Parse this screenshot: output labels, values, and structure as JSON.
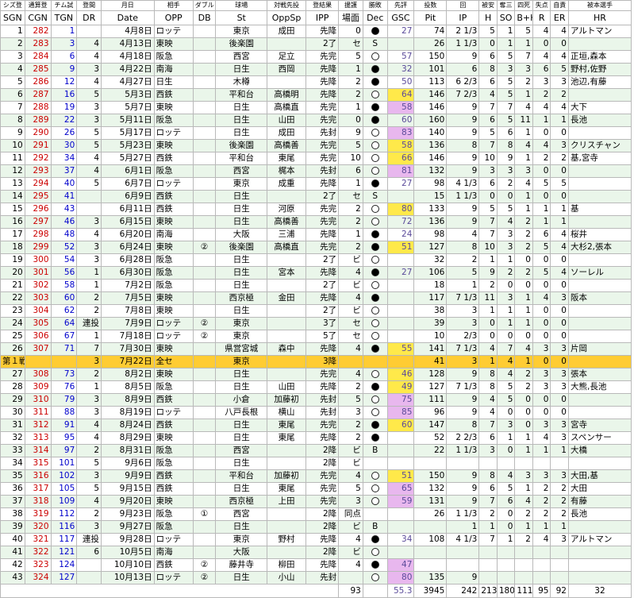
{
  "header_jp": [
    "シズ登",
    "通算登",
    "チム試",
    "登",
    "間",
    "月日",
    "相手",
    "ダブル",
    "球場",
    "対戦先投",
    "登結果",
    "援護",
    "勝敗",
    "先評",
    "投数",
    "回",
    "被安",
    "奪三",
    "四死",
    "失点",
    "自責",
    "被本選手"
  ],
  "header_en": [
    "SGN",
    "CGN",
    "TGN",
    "DR",
    "Date",
    "OPP",
    "DB",
    "St",
    "OppSp",
    "IPP",
    "場面",
    "Dec",
    "GSC",
    "Pit",
    "IP",
    "H",
    "SO",
    "B+H",
    "R",
    "ER",
    "HR"
  ],
  "legend_circles": {
    "black": "●",
    "white": "○"
  },
  "rows": [
    {
      "sgn": "1",
      "cgn": "282",
      "tgn": "1",
      "dr": "",
      "date": "4月8日",
      "opp": "ロッテ",
      "db": "",
      "st": "東京",
      "oppsp": "成田",
      "ipp": "先降",
      "scene": "0",
      "dec": "black",
      "gsc": "27",
      "gsc_c": "",
      "pit": "74",
      "ip": "2 1/3",
      "h": "5",
      "so": "1",
      "bh": "5",
      "r": "4",
      "er": "4",
      "hr": "アルトマン"
    },
    {
      "sgn": "2",
      "cgn": "283",
      "tgn": "3",
      "dr": "4",
      "date": "4月13日",
      "opp": "東映",
      "db": "",
      "st": "後楽園",
      "oppsp": "",
      "ipp": "2了",
      "scene": "セ",
      "dec": "S",
      "gsc": "",
      "gsc_c": "",
      "pit": "26",
      "ip": "1 1/3",
      "h": "0",
      "so": "1",
      "bh": "1",
      "r": "0",
      "er": "0",
      "hr": ""
    },
    {
      "sgn": "3",
      "cgn": "284",
      "tgn": "6",
      "dr": "4",
      "date": "4月18日",
      "opp": "阪急",
      "db": "",
      "st": "西宮",
      "oppsp": "足立",
      "ipp": "先完",
      "scene": "5",
      "dec": "white",
      "gsc": "57",
      "gsc_c": "",
      "pit": "150",
      "ip": "9",
      "h": "6",
      "so": "5",
      "bh": "7",
      "r": "4",
      "er": "4",
      "hr": "正垣,森本"
    },
    {
      "sgn": "4",
      "cgn": "285",
      "tgn": "9",
      "dr": "3",
      "date": "4月22日",
      "opp": "南海",
      "db": "",
      "st": "日生",
      "oppsp": "西岡",
      "ipp": "先降",
      "scene": "1",
      "dec": "black",
      "gsc": "32",
      "gsc_c": "",
      "pit": "101",
      "ip": "6",
      "h": "8",
      "so": "3",
      "bh": "3",
      "r": "6",
      "er": "5",
      "hr": "野村,佐野"
    },
    {
      "sgn": "5",
      "cgn": "286",
      "tgn": "12",
      "dr": "4",
      "date": "4月27日",
      "opp": "日生",
      "db": "",
      "st": "木樽",
      "oppsp": "",
      "ipp": "先降",
      "scene": "2",
      "dec": "black",
      "gsc": "50",
      "gsc_c": "",
      "pit": "113",
      "ip": "6 2/3",
      "h": "6",
      "so": "5",
      "bh": "2",
      "r": "3",
      "er": "3",
      "hr": "池辺,有藤"
    },
    {
      "sgn": "6",
      "cgn": "287",
      "tgn": "16",
      "dr": "5",
      "date": "5月3日",
      "opp": "西鉄",
      "db": "",
      "st": "平和台",
      "oppsp": "高橋明",
      "ipp": "先降",
      "scene": "2",
      "dec": "white",
      "gsc": "64",
      "gsc_c": "y",
      "pit": "146",
      "ip": "7 2/3",
      "h": "4",
      "so": "5",
      "bh": "1",
      "r": "2",
      "er": "2",
      "hr": ""
    },
    {
      "sgn": "7",
      "cgn": "288",
      "tgn": "19",
      "dr": "3",
      "date": "5月7日",
      "opp": "東映",
      "db": "",
      "st": "日生",
      "oppsp": "高橋直",
      "ipp": "先完",
      "scene": "1",
      "dec": "black",
      "gsc": "58",
      "gsc_c": "v",
      "pit": "146",
      "ip": "9",
      "h": "7",
      "so": "7",
      "bh": "4",
      "r": "4",
      "er": "4",
      "hr": "大下"
    },
    {
      "sgn": "8",
      "cgn": "289",
      "tgn": "22",
      "dr": "3",
      "date": "5月11日",
      "opp": "阪急",
      "db": "",
      "st": "日生",
      "oppsp": "山田",
      "ipp": "先完",
      "scene": "0",
      "dec": "black",
      "gsc": "60",
      "gsc_c": "",
      "pit": "160",
      "ip": "9",
      "h": "6",
      "so": "5",
      "bh": "11",
      "r": "1",
      "er": "1",
      "hr": "長池"
    },
    {
      "sgn": "9",
      "cgn": "290",
      "tgn": "26",
      "dr": "5",
      "date": "5月17日",
      "opp": "ロッテ",
      "db": "",
      "st": "日生",
      "oppsp": "成田",
      "ipp": "先封",
      "scene": "9",
      "dec": "white",
      "gsc": "83",
      "gsc_c": "v",
      "pit": "140",
      "ip": "9",
      "h": "5",
      "so": "6",
      "bh": "1",
      "r": "0",
      "er": "0",
      "hr": ""
    },
    {
      "sgn": "10",
      "cgn": "291",
      "tgn": "30",
      "dr": "5",
      "date": "5月23日",
      "opp": "東映",
      "db": "",
      "st": "後楽園",
      "oppsp": "高橋善",
      "ipp": "先完",
      "scene": "5",
      "dec": "white",
      "gsc": "58",
      "gsc_c": "y",
      "pit": "136",
      "ip": "8",
      "h": "7",
      "so": "8",
      "bh": "4",
      "r": "4",
      "er": "3",
      "hr": "クリスチャン"
    },
    {
      "sgn": "11",
      "cgn": "292",
      "tgn": "34",
      "dr": "4",
      "date": "5月27日",
      "opp": "西鉄",
      "db": "",
      "st": "平和台",
      "oppsp": "東尾",
      "ipp": "先完",
      "scene": "10",
      "dec": "white",
      "gsc": "66",
      "gsc_c": "y",
      "pit": "146",
      "ip": "9",
      "h": "10",
      "so": "9",
      "bh": "1",
      "r": "2",
      "er": "2",
      "hr": "基,宮寺"
    },
    {
      "sgn": "12",
      "cgn": "293",
      "tgn": "37",
      "dr": "4",
      "date": "6月1日",
      "opp": "阪急",
      "db": "",
      "st": "西宮",
      "oppsp": "梶本",
      "ipp": "先封",
      "scene": "6",
      "dec": "white",
      "gsc": "81",
      "gsc_c": "v",
      "pit": "132",
      "ip": "9",
      "h": "3",
      "so": "3",
      "bh": "3",
      "r": "0",
      "er": "0",
      "hr": ""
    },
    {
      "sgn": "13",
      "cgn": "294",
      "tgn": "40",
      "dr": "5",
      "date": "6月7日",
      "opp": "ロッテ",
      "db": "",
      "st": "東京",
      "oppsp": "成重",
      "ipp": "先降",
      "scene": "1",
      "dec": "black",
      "gsc": "27",
      "gsc_c": "",
      "pit": "98",
      "ip": "4 1/3",
      "h": "6",
      "so": "2",
      "bh": "4",
      "r": "5",
      "er": "5",
      "hr": ""
    },
    {
      "sgn": "14",
      "cgn": "295",
      "tgn": "41",
      "dr": "",
      "date": "6月9日",
      "opp": "西鉄",
      "db": "",
      "st": "日生",
      "oppsp": "",
      "ipp": "2了",
      "scene": "セ",
      "dec": "S",
      "gsc": "",
      "gsc_c": "",
      "pit": "15",
      "ip": "1 1/3",
      "h": "0",
      "so": "0",
      "bh": "1",
      "r": "0",
      "er": "0",
      "hr": ""
    },
    {
      "sgn": "15",
      "cgn": "296",
      "tgn": "43",
      "dr": "",
      "date": "6月11日",
      "opp": "西鉄",
      "db": "",
      "st": "日生",
      "oppsp": "河原",
      "ipp": "先完",
      "scene": "2",
      "dec": "white",
      "gsc": "80",
      "gsc_c": "y",
      "pit": "133",
      "ip": "9",
      "h": "5",
      "so": "5",
      "bh": "1",
      "r": "1",
      "er": "1",
      "hr": "基"
    },
    {
      "sgn": "16",
      "cgn": "297",
      "tgn": "46",
      "dr": "3",
      "date": "6月15日",
      "opp": "東映",
      "db": "",
      "st": "日生",
      "oppsp": "高橋善",
      "ipp": "先完",
      "scene": "2",
      "dec": "white",
      "gsc": "72",
      "gsc_c": "",
      "pit": "136",
      "ip": "9",
      "h": "7",
      "so": "4",
      "bh": "2",
      "r": "1",
      "er": "1",
      "hr": ""
    },
    {
      "sgn": "17",
      "cgn": "298",
      "tgn": "48",
      "dr": "4",
      "date": "6月20日",
      "opp": "南海",
      "db": "",
      "st": "大阪",
      "oppsp": "三浦",
      "ipp": "先降",
      "scene": "1",
      "dec": "black",
      "gsc": "24",
      "gsc_c": "",
      "pit": "98",
      "ip": "4",
      "h": "7",
      "so": "3",
      "bh": "2",
      "r": "6",
      "er": "4",
      "hr": "桜井"
    },
    {
      "sgn": "18",
      "cgn": "299",
      "tgn": "52",
      "dr": "3",
      "date": "6月24日",
      "opp": "東映",
      "db": "②",
      "st": "後楽園",
      "oppsp": "高橋直",
      "ipp": "先完",
      "scene": "2",
      "dec": "black",
      "gsc": "51",
      "gsc_c": "y",
      "pit": "127",
      "ip": "8",
      "h": "10",
      "so": "3",
      "bh": "2",
      "r": "5",
      "er": "4",
      "hr": "大杉2,張本"
    },
    {
      "sgn": "19",
      "cgn": "300",
      "tgn": "54",
      "dr": "3",
      "date": "6月28日",
      "opp": "阪急",
      "db": "",
      "st": "日生",
      "oppsp": "",
      "ipp": "2了",
      "scene": "ビ",
      "dec": "white",
      "gsc": "",
      "gsc_c": "",
      "pit": "32",
      "ip": "2",
      "h": "1",
      "so": "1",
      "bh": "0",
      "r": "0",
      "er": "0",
      "hr": ""
    },
    {
      "sgn": "20",
      "cgn": "301",
      "tgn": "56",
      "dr": "1",
      "date": "6月30日",
      "opp": "阪急",
      "db": "",
      "st": "日生",
      "oppsp": "宮本",
      "ipp": "先降",
      "scene": "4",
      "dec": "black",
      "gsc": "27",
      "gsc_c": "",
      "pit": "106",
      "ip": "5",
      "h": "9",
      "so": "2",
      "bh": "2",
      "r": "5",
      "er": "4",
      "hr": "ソーレル"
    },
    {
      "sgn": "21",
      "cgn": "302",
      "tgn": "58",
      "dr": "1",
      "date": "7月2日",
      "opp": "阪急",
      "db": "",
      "st": "日生",
      "oppsp": "",
      "ipp": "2了",
      "scene": "ビ",
      "dec": "white",
      "gsc": "",
      "gsc_c": "",
      "pit": "18",
      "ip": "1",
      "h": "2",
      "so": "0",
      "bh": "0",
      "r": "0",
      "er": "0",
      "hr": ""
    },
    {
      "sgn": "22",
      "cgn": "303",
      "tgn": "60",
      "dr": "2",
      "date": "7月5日",
      "opp": "東映",
      "db": "",
      "st": "西京極",
      "oppsp": "金田",
      "ipp": "先降",
      "scene": "4",
      "dec": "black",
      "gsc": "",
      "gsc_c": "",
      "pit": "117",
      "ip": "7 1/3",
      "h": "11",
      "so": "3",
      "bh": "1",
      "r": "4",
      "er": "3",
      "hr": "阪本"
    },
    {
      "sgn": "23",
      "cgn": "304",
      "tgn": "62",
      "dr": "2",
      "date": "7月8日",
      "opp": "東映",
      "db": "",
      "st": "日生",
      "oppsp": "",
      "ipp": "2了",
      "scene": "ビ",
      "dec": "white",
      "gsc": "",
      "gsc_c": "",
      "pit": "38",
      "ip": "3",
      "h": "1",
      "so": "1",
      "bh": "1",
      "r": "0",
      "er": "0",
      "hr": ""
    },
    {
      "sgn": "24",
      "cgn": "305",
      "tgn": "64",
      "dr": "連投",
      "date": "7月9日",
      "opp": "ロッテ",
      "db": "②",
      "st": "東京",
      "oppsp": "",
      "ipp": "3了",
      "scene": "セ",
      "dec": "white",
      "gsc": "",
      "gsc_c": "",
      "pit": "39",
      "ip": "3",
      "h": "0",
      "so": "1",
      "bh": "1",
      "r": "0",
      "er": "0",
      "hr": ""
    },
    {
      "sgn": "25",
      "cgn": "306",
      "tgn": "67",
      "dr": "1",
      "date": "7月18日",
      "opp": "ロッテ",
      "db": "②",
      "st": "東京",
      "oppsp": "",
      "ipp": "5了",
      "scene": "セ",
      "dec": "white",
      "gsc": "",
      "gsc_c": "",
      "pit": "10",
      "ip": "2/3",
      "h": "0",
      "so": "0",
      "bh": "0",
      "r": "0",
      "er": "0",
      "hr": ""
    },
    {
      "sgn": "26",
      "cgn": "307",
      "tgn": "71",
      "dr": "7",
      "date": "7月30日",
      "opp": "東映",
      "db": "",
      "st": "県営宮城",
      "oppsp": "森中",
      "ipp": "先降",
      "scene": "4",
      "dec": "black",
      "gsc": "55",
      "gsc_c": "y",
      "pit": "141",
      "ip": "7 1/3",
      "h": "4",
      "so": "7",
      "bh": "4",
      "r": "3",
      "er": "3",
      "hr": "片岡",
      "special": "true"
    },
    {
      "sgn": "第１戦",
      "cgn": "",
      "tgn": "",
      "dr": "3",
      "date": "7月22日",
      "opp": "全セ",
      "db": "",
      "st": "東京",
      "oppsp": "",
      "ipp": "3降",
      "scene": "",
      "dec": "",
      "gsc": "",
      "gsc_c": "",
      "pit": "41",
      "ip": "3",
      "h": "1",
      "so": "4",
      "bh": "1",
      "r": "0",
      "er": "0",
      "hr": "",
      "special_row": "true"
    },
    {
      "sgn": "27",
      "cgn": "308",
      "tgn": "73",
      "dr": "2",
      "date": "8月2日",
      "opp": "東映",
      "db": "",
      "st": "日生",
      "oppsp": "",
      "ipp": "先完",
      "scene": "4",
      "dec": "white",
      "gsc": "46",
      "gsc_c": "y",
      "pit": "128",
      "ip": "9",
      "h": "8",
      "so": "4",
      "bh": "2",
      "r": "3",
      "er": "3",
      "hr": "張本"
    },
    {
      "sgn": "28",
      "cgn": "309",
      "tgn": "76",
      "dr": "1",
      "date": "8月5日",
      "opp": "阪急",
      "db": "",
      "st": "日生",
      "oppsp": "山田",
      "ipp": "先降",
      "scene": "2",
      "dec": "black",
      "gsc": "49",
      "gsc_c": "y",
      "pit": "127",
      "ip": "7 1/3",
      "h": "8",
      "so": "5",
      "bh": "2",
      "r": "3",
      "er": "3",
      "hr": "大熊,長池"
    },
    {
      "sgn": "29",
      "cgn": "310",
      "tgn": "79",
      "dr": "3",
      "date": "8月9日",
      "opp": "西鉄",
      "db": "",
      "st": "小倉",
      "oppsp": "加藤初",
      "ipp": "先封",
      "scene": "5",
      "dec": "white",
      "gsc": "75",
      "gsc_c": "v",
      "pit": "111",
      "ip": "9",
      "h": "4",
      "so": "5",
      "bh": "0",
      "r": "0",
      "er": "0",
      "hr": ""
    },
    {
      "sgn": "30",
      "cgn": "311",
      "tgn": "88",
      "dr": "3",
      "date": "8月19日",
      "opp": "ロッテ",
      "db": "",
      "st": "八戸長根",
      "oppsp": "横山",
      "ipp": "先封",
      "scene": "3",
      "dec": "white",
      "gsc": "85",
      "gsc_c": "v",
      "pit": "96",
      "ip": "9",
      "h": "4",
      "so": "0",
      "bh": "0",
      "r": "0",
      "er": "0",
      "hr": ""
    },
    {
      "sgn": "31",
      "cgn": "312",
      "tgn": "91",
      "dr": "4",
      "date": "8月24日",
      "opp": "西鉄",
      "db": "",
      "st": "日生",
      "oppsp": "東尾",
      "ipp": "先完",
      "scene": "2",
      "dec": "black",
      "gsc": "60",
      "gsc_c": "y",
      "pit": "147",
      "ip": "8",
      "h": "7",
      "so": "3",
      "bh": "0",
      "r": "3",
      "er": "3",
      "hr": "宮寺"
    },
    {
      "sgn": "32",
      "cgn": "313",
      "tgn": "95",
      "dr": "4",
      "date": "8月29日",
      "opp": "東映",
      "db": "",
      "st": "日生",
      "oppsp": "東尾",
      "ipp": "先降",
      "scene": "2",
      "dec": "black",
      "gsc": "",
      "gsc_c": "",
      "pit": "52",
      "ip": "2 2/3",
      "h": "6",
      "so": "1",
      "bh": "1",
      "r": "4",
      "er": "3",
      "hr": "スペンサー"
    },
    {
      "sgn": "33",
      "cgn": "314",
      "tgn": "97",
      "dr": "2",
      "date": "8月31日",
      "opp": "阪急",
      "db": "",
      "st": "西宮",
      "oppsp": "",
      "ipp": "2降",
      "scene": "ビ",
      "dec": "B",
      "gsc": "",
      "gsc_c": "",
      "pit": "22",
      "ip": "1 1/3",
      "h": "3",
      "so": "0",
      "bh": "1",
      "r": "1",
      "er": "1",
      "hr": "大橋"
    },
    {
      "sgn": "34",
      "cgn": "315",
      "tgn": "101",
      "dr": "5",
      "date": "9月6日",
      "opp": "阪急",
      "db": "",
      "st": "日生",
      "oppsp": "",
      "ipp": "2降",
      "scene": "ビ",
      "dec": "",
      "gsc": "",
      "gsc_c": "",
      "pit": "",
      "ip": "",
      "h": "",
      "so": "",
      "bh": "",
      "r": "",
      "er": "",
      "hr": ""
    },
    {
      "sgn": "35",
      "cgn": "316",
      "tgn": "102",
      "dr": "3",
      "date": "9月9日",
      "opp": "西鉄",
      "db": "",
      "st": "平和台",
      "oppsp": "加藤初",
      "ipp": "先完",
      "scene": "4",
      "dec": "white",
      "gsc": "51",
      "gsc_c": "y",
      "pit": "150",
      "ip": "9",
      "h": "8",
      "so": "4",
      "bh": "3",
      "r": "3",
      "er": "3",
      "hr": "大田,基"
    },
    {
      "sgn": "36",
      "cgn": "317",
      "tgn": "105",
      "dr": "5",
      "date": "9月15日",
      "opp": "西鉄",
      "db": "",
      "st": "日生",
      "oppsp": "東尾",
      "ipp": "先完",
      "scene": "5",
      "dec": "white",
      "gsc": "65",
      "gsc_c": "v",
      "pit": "132",
      "ip": "9",
      "h": "6",
      "so": "5",
      "bh": "1",
      "r": "2",
      "er": "2",
      "hr": "大田"
    },
    {
      "sgn": "37",
      "cgn": "318",
      "tgn": "109",
      "dr": "4",
      "date": "9月20日",
      "opp": "東映",
      "db": "",
      "st": "西京極",
      "oppsp": "上田",
      "ipp": "先完",
      "scene": "3",
      "dec": "white",
      "gsc": "59",
      "gsc_c": "v",
      "pit": "131",
      "ip": "9",
      "h": "7",
      "so": "6",
      "bh": "4",
      "r": "2",
      "er": "2",
      "hr": "有藤"
    },
    {
      "sgn": "38",
      "cgn": "319",
      "tgn": "112",
      "dr": "2",
      "date": "9月23日",
      "opp": "阪急",
      "db": "①",
      "st": "西宮",
      "oppsp": "",
      "ipp": "2降",
      "scene": "同点",
      "dec": "",
      "gsc": "",
      "gsc_c": "",
      "pit": "26",
      "ip": "1 1/3",
      "h": "2",
      "so": "0",
      "bh": "2",
      "r": "2",
      "er": "2",
      "hr": "長池"
    },
    {
      "sgn": "39",
      "cgn": "320",
      "tgn": "116",
      "dr": "3",
      "date": "9月27日",
      "opp": "阪急",
      "db": "",
      "st": "日生",
      "oppsp": "",
      "ipp": "2降",
      "scene": "ビ",
      "dec": "B",
      "gsc": "",
      "gsc_c": "",
      "pit": "",
      "ip": "1",
      "h": "1",
      "so": "0",
      "bh": "1",
      "r": "1",
      "er": "1",
      "hr": ""
    },
    {
      "sgn": "40",
      "cgn": "321",
      "tgn": "117",
      "dr": "連投",
      "date": "9月28日",
      "opp": "ロッテ",
      "db": "",
      "st": "東京",
      "oppsp": "野村",
      "ipp": "先降",
      "scene": "4",
      "dec": "black",
      "gsc": "34",
      "gsc_c": "",
      "pit": "108",
      "ip": "4 1/3",
      "h": "7",
      "so": "1",
      "bh": "2",
      "r": "4",
      "er": "3",
      "hr": "アルトマン"
    },
    {
      "sgn": "41",
      "cgn": "322",
      "tgn": "121",
      "dr": "6",
      "date": "10月5日",
      "opp": "南海",
      "db": "",
      "st": "大阪",
      "oppsp": "",
      "ipp": "2降",
      "scene": "ビ",
      "dec": "white",
      "gsc": "",
      "gsc_c": "",
      "pit": "",
      "ip": "",
      "h": "",
      "so": "",
      "bh": "",
      "r": "",
      "er": "",
      "hr": ""
    },
    {
      "sgn": "42",
      "cgn": "323",
      "tgn": "124",
      "dr": "",
      "date": "10月10日",
      "opp": "西鉄",
      "db": "②",
      "st": "藤井寺",
      "oppsp": "柳田",
      "ipp": "先降",
      "scene": "4",
      "dec": "black",
      "gsc": "47",
      "gsc_c": "v",
      "pit": "",
      "ip": "",
      "h": "",
      "so": "",
      "bh": "",
      "r": "",
      "er": "",
      "hr": ""
    },
    {
      "sgn": "43",
      "cgn": "324",
      "tgn": "127",
      "dr": "",
      "date": "10月13日",
      "opp": "ロッテ",
      "db": "②",
      "st": "日生",
      "oppsp": "小山",
      "ipp": "先封",
      "scene": "",
      "dec": "white",
      "gsc": "80",
      "gsc_c": "v",
      "pit": "135",
      "ip": "9",
      "h": "",
      "so": "",
      "bh": "",
      "r": "",
      "er": "",
      "hr": ""
    }
  ],
  "totals": {
    "scene": "93",
    "gsc": "55.3",
    "pit": "3945",
    "ip": "242",
    "h": "213",
    "so": "180",
    "bh": "111",
    "r": "95",
    "er": "92",
    "hr": "32"
  }
}
